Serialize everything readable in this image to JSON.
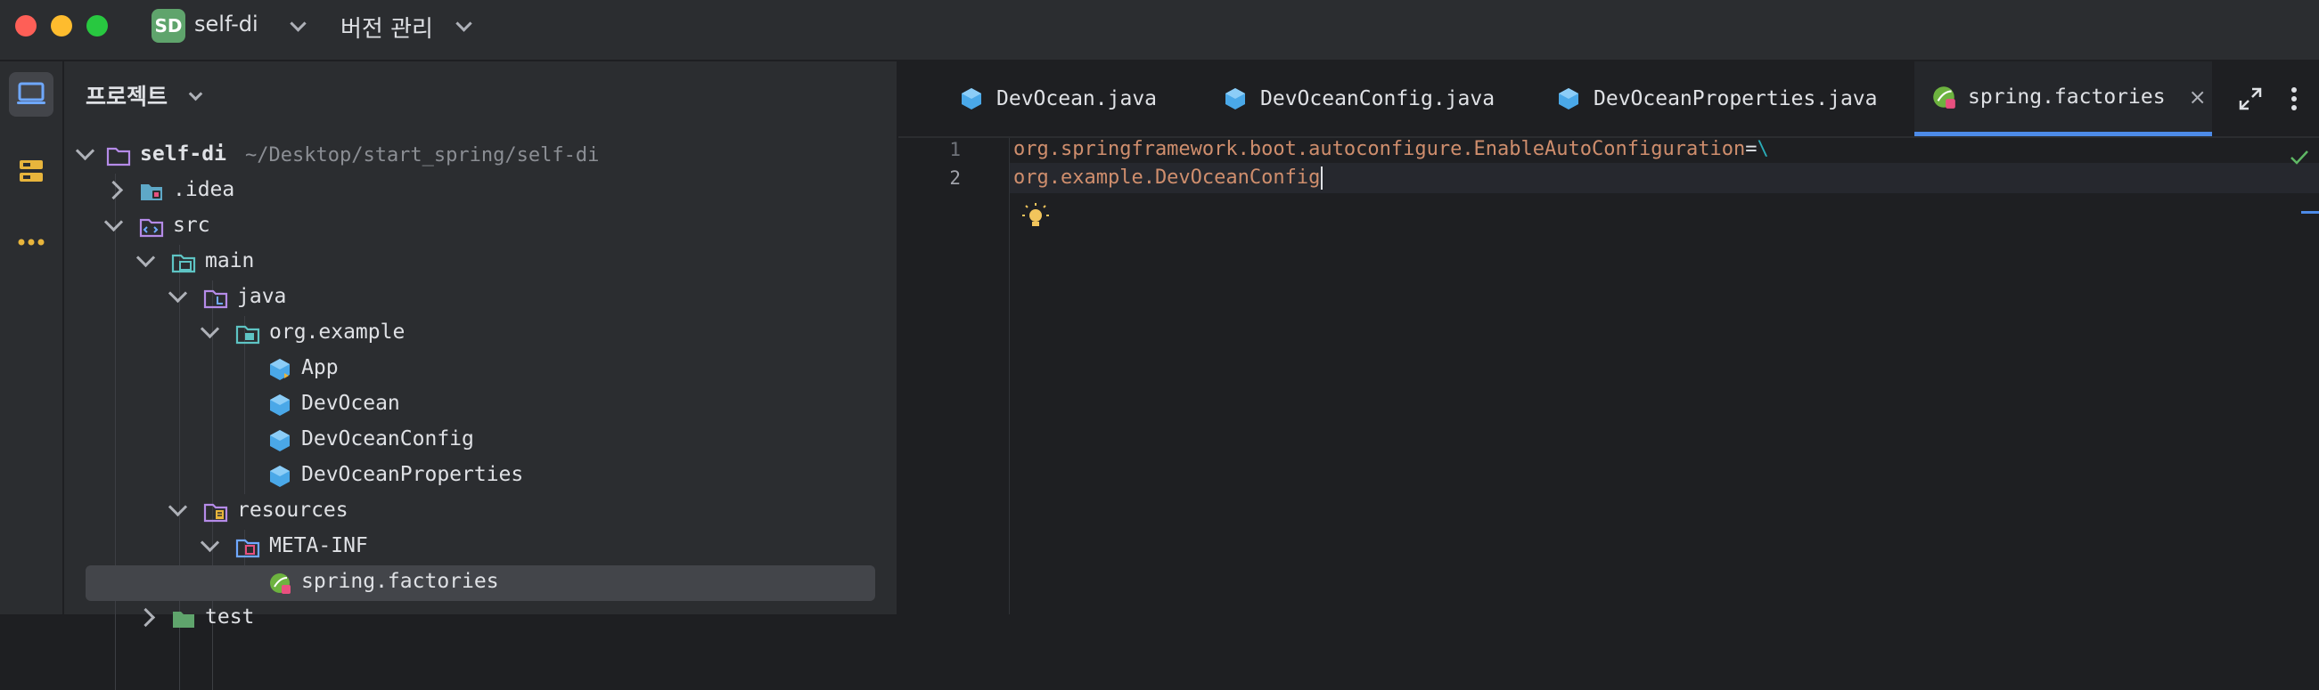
{
  "titlebar": {
    "project_badge": "SD",
    "project_name": "self-di",
    "version_control": "버전 관리"
  },
  "toolstrip": {
    "items": [
      {
        "icon": "project-icon",
        "active": true
      },
      {
        "icon": "structure-icon",
        "active": false
      },
      {
        "icon": "more-icon",
        "active": false
      }
    ]
  },
  "panel": {
    "title": "프로젝트"
  },
  "tree": {
    "root": {
      "label": "self-di",
      "path": "~/Desktop/start_spring/self-di"
    },
    "idea": ".idea",
    "src": "src",
    "main": "main",
    "java": "java",
    "package": "org.example",
    "classes": [
      "App",
      "DevOcean",
      "DevOceanConfig",
      "DevOceanProperties"
    ],
    "resources": "resources",
    "metainf": "META-INF",
    "factories": "spring.factories",
    "test": "test"
  },
  "tabs": [
    {
      "label": "DevOcean.java",
      "icon": "java-class-icon"
    },
    {
      "label": "DevOceanConfig.java",
      "icon": "java-class-icon"
    },
    {
      "label": "DevOceanProperties.java",
      "icon": "java-class-icon"
    },
    {
      "label": "spring.factories",
      "icon": "spring-icon",
      "active": true
    }
  ],
  "tab_close": "×",
  "editor": {
    "lines": [
      {
        "number": "1",
        "key": "org.springframework.boot.autoconfigure.EnableAutoConfiguration",
        "eq": "=",
        "esc": "\\"
      },
      {
        "number": "2",
        "value": "org.example.DevOceanConfig"
      }
    ]
  },
  "colors": {
    "accent": "#4d8be8",
    "key": "#cf8e6d",
    "escape": "#2aacb8",
    "badge": "#5fa46c"
  }
}
